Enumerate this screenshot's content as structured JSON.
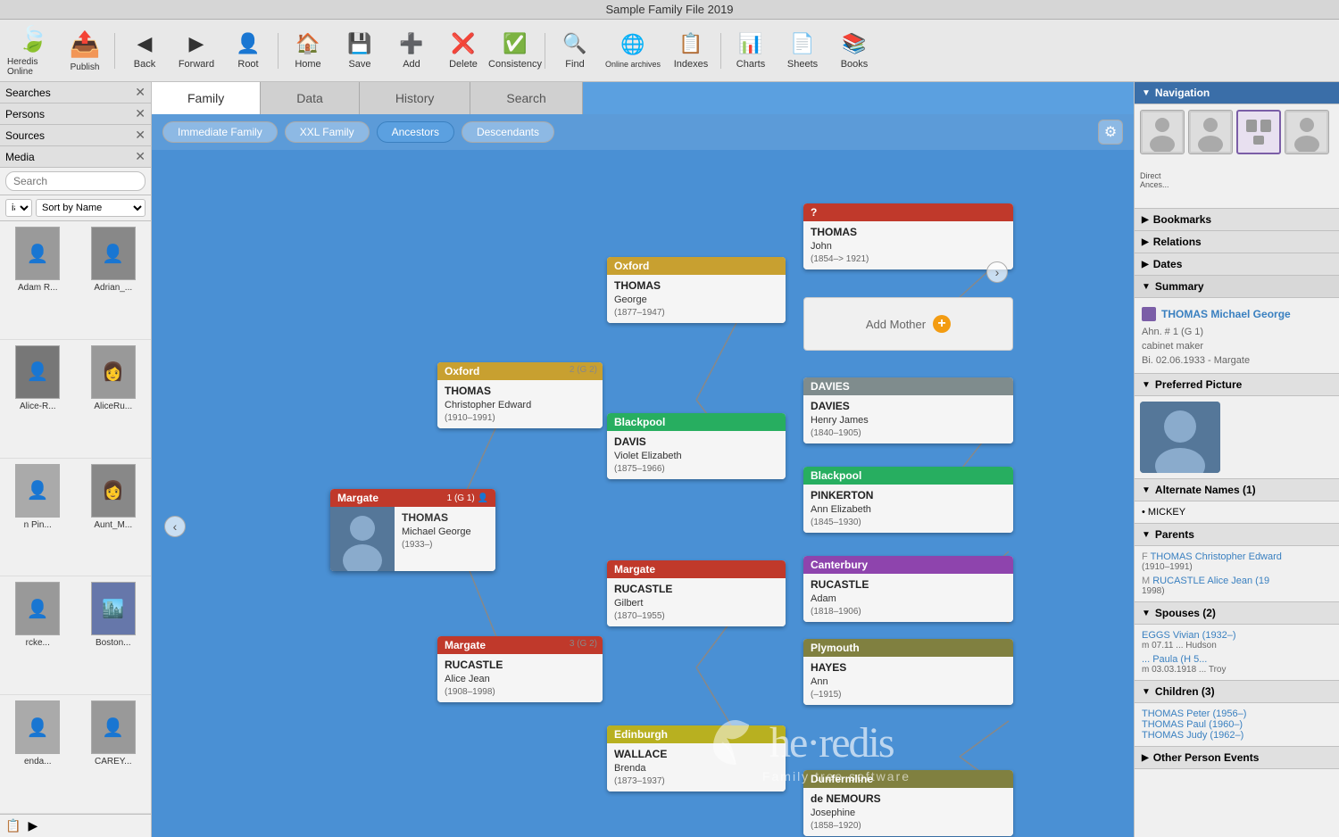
{
  "titlebar": {
    "title": "Sample Family File 2019"
  },
  "toolbar": {
    "buttons": [
      {
        "id": "back",
        "label": "Back",
        "icon": "◀"
      },
      {
        "id": "forward",
        "label": "Forward",
        "icon": "▶"
      },
      {
        "id": "root",
        "label": "Root",
        "icon": "👤"
      },
      {
        "id": "home",
        "label": "Home",
        "icon": "🏠"
      },
      {
        "id": "save",
        "label": "Save",
        "icon": "💾"
      },
      {
        "id": "add",
        "label": "Add",
        "icon": "➕"
      },
      {
        "id": "delete",
        "label": "Delete",
        "icon": "❌"
      },
      {
        "id": "consistency",
        "label": "Consistency",
        "icon": "✓"
      },
      {
        "id": "find",
        "label": "Find",
        "icon": "🔍"
      },
      {
        "id": "online_archives",
        "label": "Online archives",
        "icon": "🌐"
      },
      {
        "id": "indexes",
        "label": "Indexes",
        "icon": "📋"
      },
      {
        "id": "charts",
        "label": "Charts",
        "icon": "📊"
      },
      {
        "id": "sheets",
        "label": "Sheets",
        "icon": "📄"
      },
      {
        "id": "books",
        "label": "Books",
        "icon": "📚"
      }
    ]
  },
  "left_panel": {
    "headers": [
      {
        "label": "Searches",
        "id": "searches"
      },
      {
        "label": "Persons",
        "id": "persons"
      },
      {
        "label": "Sources",
        "id": "sources"
      },
      {
        "label": "Media",
        "id": "media"
      }
    ],
    "search_placeholder": "Search",
    "sort_label": "Sort by Name",
    "people": [
      {
        "id": "p1",
        "name": "Adam R...",
        "thumb": "👤"
      },
      {
        "id": "p2",
        "name": "Adrian_...",
        "thumb": "👤"
      },
      {
        "id": "p3",
        "name": "Alice-R...",
        "thumb": "👤"
      },
      {
        "id": "p4",
        "name": "AliceRu...",
        "thumb": "👩"
      },
      {
        "id": "p5",
        "name": "n Pin...",
        "thumb": "👤"
      },
      {
        "id": "p6",
        "name": "Aunt_M...",
        "thumb": "👩"
      },
      {
        "id": "p7",
        "name": "rcke...",
        "thumb": "👤"
      },
      {
        "id": "p8",
        "name": "Boston...",
        "thumb": "🏙️"
      },
      {
        "id": "p9",
        "name": "enda...",
        "thumb": "👤"
      },
      {
        "id": "p10",
        "name": "CAREY...",
        "thumb": "👤"
      }
    ]
  },
  "tabs": [
    {
      "id": "family",
      "label": "Family",
      "active": true
    },
    {
      "id": "data",
      "label": "Data"
    },
    {
      "id": "history",
      "label": "History"
    },
    {
      "id": "search",
      "label": "Search"
    }
  ],
  "view_buttons": [
    {
      "id": "immediate",
      "label": "Immediate Family"
    },
    {
      "id": "xxl",
      "label": "XXL Family"
    },
    {
      "id": "ancestors",
      "label": "Ancestors",
      "active": true
    },
    {
      "id": "descendants",
      "label": "Descendants"
    }
  ],
  "tree": {
    "root_person": {
      "id": "root",
      "location": "Margate",
      "surname": "THOMAS",
      "given": "Michael George",
      "dates": "(1933–)",
      "num": "1 (G 1)",
      "has_photo": true
    },
    "gen1_father": {
      "id": "gen1f",
      "num": "2 (G 2)",
      "location": "Oxford",
      "surname": "THOMAS",
      "given": "Christopher Edward",
      "dates": "(1910–1991)"
    },
    "gen1_mother": {
      "id": "gen1m",
      "num": "3 (G 2)",
      "location": "Margate",
      "surname": "RUCASTLE",
      "given": "Alice Jean",
      "dates": "(1908–1998)"
    },
    "gen2_ff": {
      "id": "gen2ff",
      "location": "Oxford",
      "surname": "THOMAS",
      "given": "George",
      "dates": "(1877–1947)"
    },
    "gen2_fm": {
      "id": "gen2fm",
      "location": "Blackpool",
      "surname": "DAVIS",
      "given": "Violet Elizabeth",
      "dates": "(1875–1966)"
    },
    "gen2_mf": {
      "id": "gen2mf",
      "location": "Margate",
      "surname": "RUCASTLE",
      "given": "Gilbert",
      "dates": "(1870–1955)"
    },
    "gen2_mm": {
      "id": "gen2mm",
      "location": "Edinburgh",
      "surname": "WALLACE",
      "given": "Brenda",
      "dates": "(1873–1937)"
    },
    "gen3_fff": {
      "id": "gen3fff",
      "location": "?",
      "header_style": "thomas-q",
      "surname": "THOMAS",
      "given": "John",
      "dates": "(1854–> 1921)"
    },
    "gen3_ffm": {
      "id": "gen3ffm",
      "label": "Add Mother",
      "type": "add"
    },
    "gen3_fmf": {
      "id": "gen3fmf",
      "location": "DAVIES",
      "header_style": "davies",
      "surname": "DAVIES",
      "given": "Henry James",
      "dates": "(1840–1905)"
    },
    "gen3_fmm": {
      "id": "gen3fmm",
      "location": "Blackpool",
      "header_style": "pinkerton",
      "surname": "PINKERTON",
      "given": "Ann Elizabeth",
      "dates": "(1845–1930)"
    },
    "gen3_mff": {
      "id": "gen3mff",
      "location": "Canterbury",
      "header_style": "canterbury",
      "surname": "RUCASTLE",
      "given": "Adam",
      "dates": "(1818–1906)"
    },
    "gen3_mfm": {
      "id": "gen3mfm",
      "location": "Plymouth",
      "header_style": "plymouth",
      "surname": "HAYES",
      "given": "Ann",
      "dates": "(–1915)"
    },
    "gen3_mmf": {
      "id": "gen3mmf",
      "location": "?",
      "header_style": "dunfermline",
      "surname": "de NEMOURS",
      "given": "Josephine",
      "dates": "(1858–1920)"
    }
  },
  "right_panel": {
    "navigation_label": "Navigation",
    "bookmarks_label": "Bookmarks",
    "relations_label": "Relations",
    "dates_label": "Dates",
    "summary_label": "Summary",
    "summary": {
      "person_name": "THOMAS Michael George",
      "ahn_num": "Ahn. # 1 (G 1)",
      "occupation": "cabinet maker",
      "birth": "02.06.1933 - Margate"
    },
    "preferred_picture_label": "Preferred Picture",
    "alt_names_label": "Alternate Names (1)",
    "alt_names": [
      "MICKEY"
    ],
    "parents_label": "Parents",
    "parents": [
      {
        "label": "F",
        "name": "THOMAS Christopher Edward",
        "dates": "(1910–1991)"
      },
      {
        "label": "M",
        "name": "RUCASTLE Alice Jean (19",
        "dates": "1998)"
      }
    ],
    "spouses_label": "Spouses (2)",
    "spouses": [
      {
        "name": "EGGS Vivian (1932–)",
        "detail": "m. 07.11 ... Hudson"
      },
      {
        "name": "... Paula (H 5...",
        "detail": "m. 03.03.1918 ... Troy"
      }
    ],
    "children_label": "Children (3)",
    "children": [
      {
        "name": "THOMAS Peter (1956–)"
      },
      {
        "name": "THOMAS Paul (1960–)"
      },
      {
        "name": "THOMAS Judy (1962–)"
      }
    ],
    "other_events_label": "Other Person Events"
  }
}
